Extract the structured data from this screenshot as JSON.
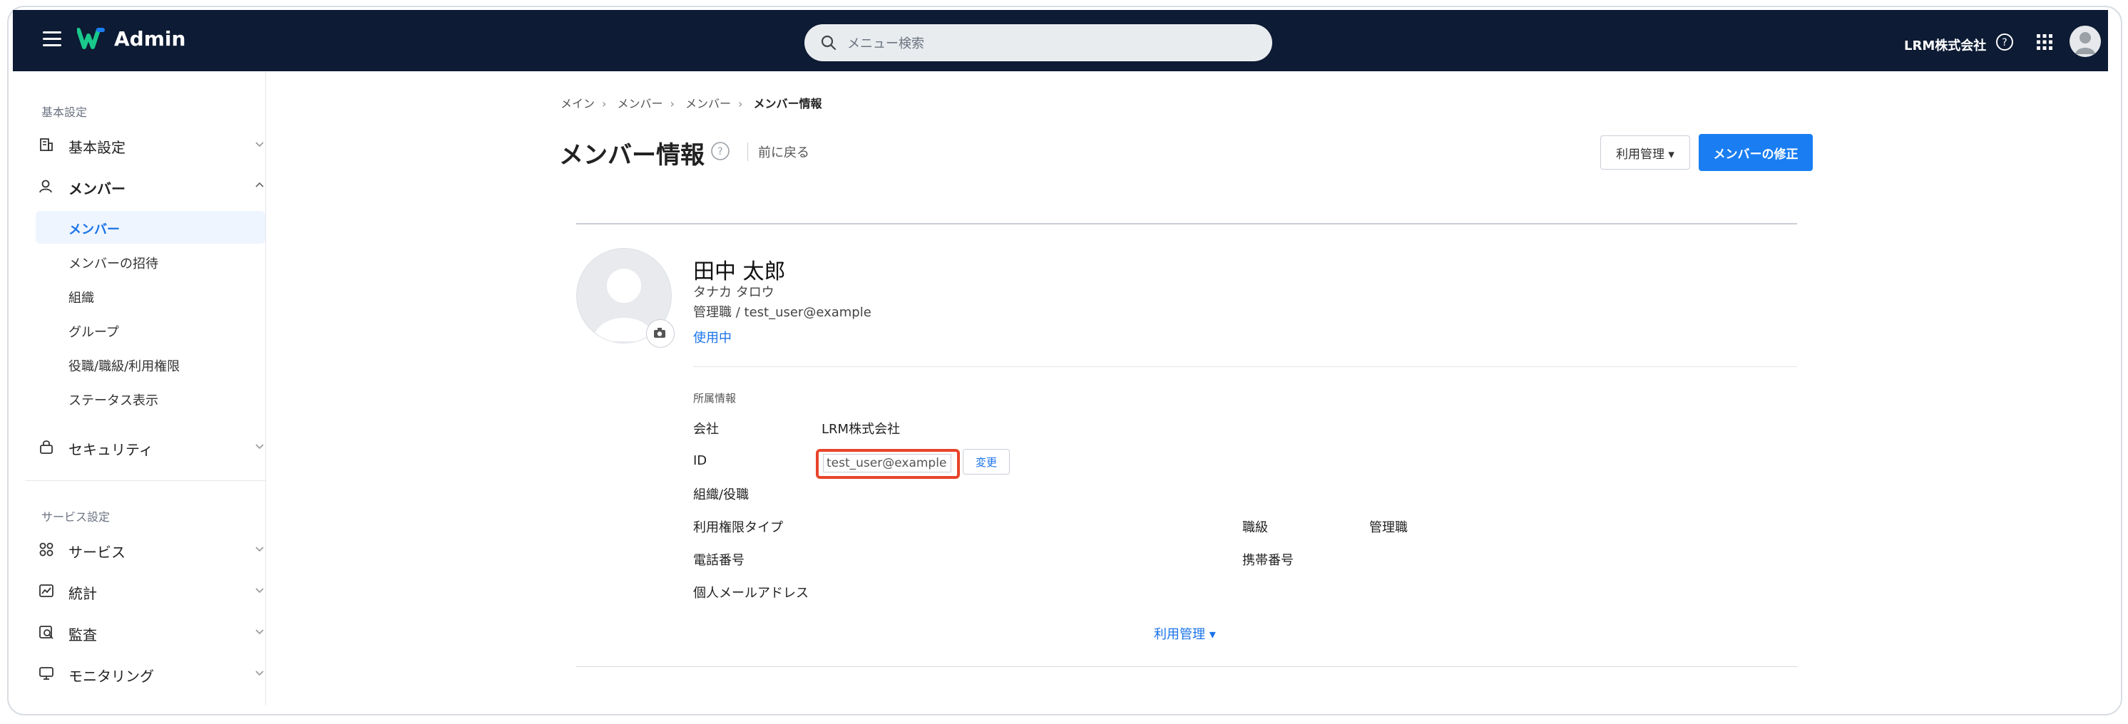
{
  "header": {
    "app_title": "Admin",
    "search_placeholder": "メニュー検索",
    "company": "LRM株式会社",
    "brand_color": "#0d1b34",
    "accent_color": "#1a7ef2"
  },
  "sidebar": {
    "section_basic": "基本設定",
    "items_basic": [
      {
        "label": "基本設定",
        "icon": "building-icon"
      },
      {
        "label": "メンバー",
        "icon": "member-icon"
      }
    ],
    "member_sub": [
      {
        "label": "メンバー"
      },
      {
        "label": "メンバーの招待"
      },
      {
        "label": "組織"
      },
      {
        "label": "グループ"
      },
      {
        "label": "役職/職級/利用権限"
      },
      {
        "label": "ステータス表示"
      }
    ],
    "security": {
      "label": "セキュリティ",
      "icon": "lock-icon"
    },
    "section_service": "サービス設定",
    "items_service": [
      {
        "label": "サービス",
        "icon": "grid-icon"
      },
      {
        "label": "統計",
        "icon": "chart-icon"
      },
      {
        "label": "監査",
        "icon": "audit-icon"
      },
      {
        "label": "モニタリング",
        "icon": "monitor-icon"
      }
    ]
  },
  "breadcrumb": [
    "メイン",
    "メンバー",
    "メンバー",
    "メンバー情報"
  ],
  "page": {
    "title": "メンバー情報",
    "back": "前に戻る",
    "btn_usage": "利用管理 ▾",
    "btn_edit": "メンバーの修正"
  },
  "profile": {
    "name": "田中 太郎",
    "kana": "タナカ タロウ",
    "role_email": "管理職 / test_user@example",
    "status": "使用中"
  },
  "details": {
    "section": "所属情報",
    "company_label": "会社",
    "company_value": "LRM株式会社",
    "id_label": "ID",
    "id_value": "test_user@example",
    "change": "変更",
    "org_label": "組織/役職",
    "perm_label": "利用権限タイプ",
    "grade_label": "職級",
    "grade_value": "管理職",
    "phone_label": "電話番号",
    "mobile_label": "携帯番号",
    "email_label": "個人メールアドレス",
    "usage_toggle": "利用管理 ▾"
  }
}
